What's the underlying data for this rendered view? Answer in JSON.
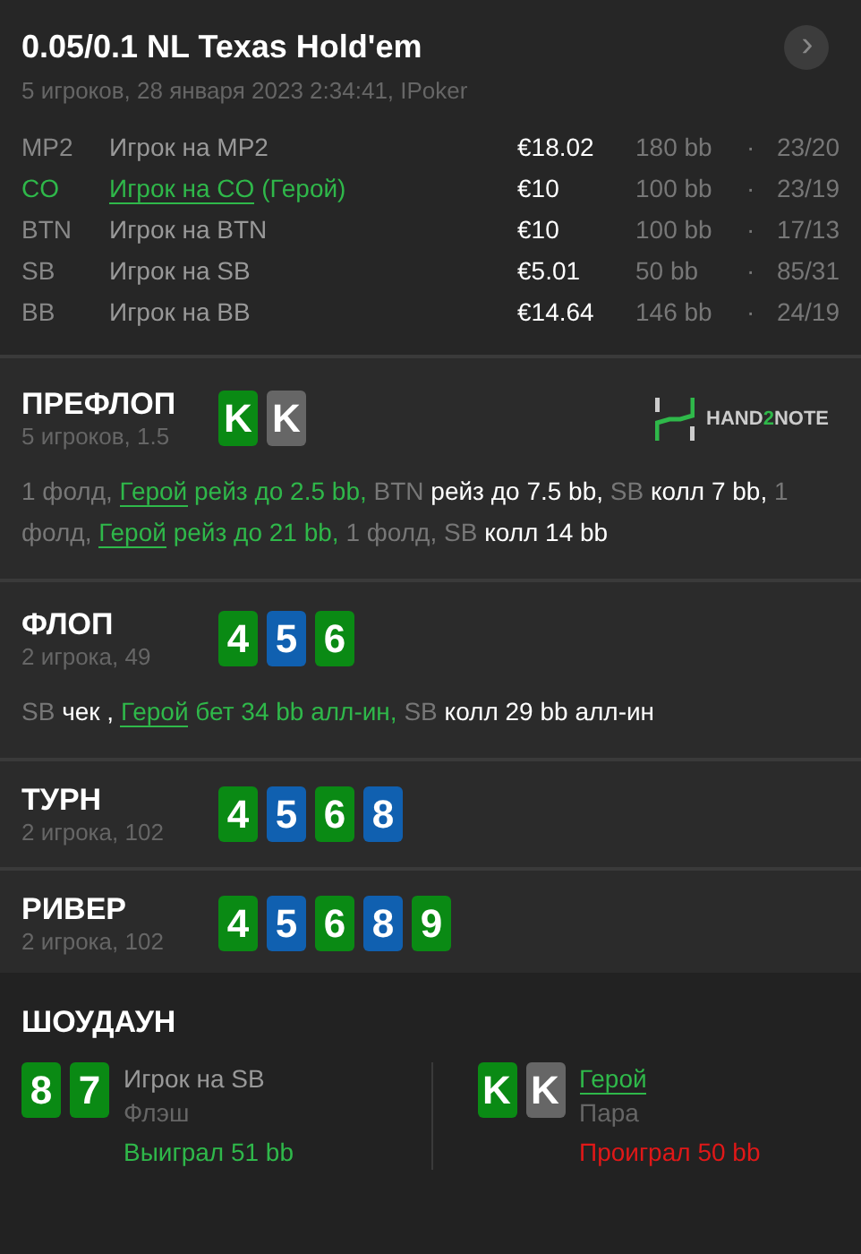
{
  "header": {
    "title": "0.05/0.1 NL Texas Hold'em",
    "subtitle": "5 игроков, 28 января 2023 2:34:41, IPoker",
    "next_button": "›",
    "players": [
      {
        "position": "MP2",
        "name": "Игрок на MP2",
        "hero": false,
        "stack": "€18.02",
        "bb": "180 bb",
        "dot": "·",
        "stats": "23/20"
      },
      {
        "position": "CO",
        "name": "Игрок на CO",
        "hero_tag": "(Герой)",
        "hero": true,
        "stack": "€10",
        "bb": "100 bb",
        "dot": "·",
        "stats": "23/19"
      },
      {
        "position": "BTN",
        "name": "Игрок на BTN",
        "hero": false,
        "stack": "€10",
        "bb": "100 bb",
        "dot": "·",
        "stats": "17/13"
      },
      {
        "position": "SB",
        "name": "Игрок на SB",
        "hero": false,
        "stack": "€5.01",
        "bb": "50 bb",
        "dot": "·",
        "stats": "85/31"
      },
      {
        "position": "BB",
        "name": "Игрок на BB",
        "hero": false,
        "stack": "€14.64",
        "bb": "146 bb",
        "dot": "·",
        "stats": "24/19"
      }
    ]
  },
  "streets": [
    {
      "name": "ПРЕФЛОП",
      "info": "5 игроков, 1.5",
      "logo": [
        {
          "text": "HAND",
          "accent": false
        },
        {
          "text": "2",
          "accent": true
        },
        {
          "text": "NOTE",
          "accent": false
        }
      ],
      "cards": [
        {
          "rank": "K",
          "color": "#0a8a14"
        },
        {
          "rank": "K",
          "color": "#666666"
        }
      ],
      "actions": [
        {
          "kind": "muted",
          "text": "1 фолд, "
        },
        {
          "kind": "hero",
          "text": "Герой"
        },
        {
          "kind": "hero_action",
          "text": " рейз до 2.5 bb, "
        },
        {
          "kind": "muted",
          "text": "BTN "
        },
        {
          "kind": "plain",
          "text": "рейз до 7.5 bb, "
        },
        {
          "kind": "muted",
          "text": "SB "
        },
        {
          "kind": "plain",
          "text": "колл 7 bb, "
        },
        {
          "kind": "muted",
          "text": "1 фолд, "
        },
        {
          "kind": "hero",
          "text": "Герой"
        },
        {
          "kind": "hero_action",
          "text": " рейз до 21 bb, "
        },
        {
          "kind": "muted",
          "text": "1 фолд, SB "
        },
        {
          "kind": "plain",
          "text": "колл 14 bb"
        }
      ]
    },
    {
      "name": "ФЛОП",
      "info": "2 игрока, 49",
      "cards": [
        {
          "rank": "4",
          "color": "#0a8a14"
        },
        {
          "rank": "5",
          "color": "#1060b0"
        },
        {
          "rank": "6",
          "color": "#0a8a14"
        }
      ],
      "actions": [
        {
          "kind": "muted",
          "text": "SB "
        },
        {
          "kind": "plain",
          "text": "чек , "
        },
        {
          "kind": "hero",
          "text": "Герой"
        },
        {
          "kind": "hero_action",
          "text": " бет 34 bb алл-ин, "
        },
        {
          "kind": "muted",
          "text": "SB "
        },
        {
          "kind": "plain",
          "text": "колл 29 bb алл-ин"
        }
      ]
    },
    {
      "name": "ТУРН",
      "info": "2 игрока, 102",
      "cards": [
        {
          "rank": "4",
          "color": "#0a8a14"
        },
        {
          "rank": "5",
          "color": "#1060b0"
        },
        {
          "rank": "6",
          "color": "#0a8a14"
        },
        {
          "rank": "8",
          "color": "#1060b0"
        }
      ]
    },
    {
      "name": "РИВЕР",
      "info": "2 игрока, 102",
      "cards": [
        {
          "rank": "4",
          "color": "#0a8a14"
        },
        {
          "rank": "5",
          "color": "#1060b0"
        },
        {
          "rank": "6",
          "color": "#0a8a14"
        },
        {
          "rank": "8",
          "color": "#1060b0"
        },
        {
          "rank": "9",
          "color": "#0a8a14"
        }
      ]
    }
  ],
  "showdown": {
    "title": "ШОУДАУН",
    "hands": [
      {
        "cards": [
          {
            "rank": "8",
            "color": "#0a8a14"
          },
          {
            "rank": "7",
            "color": "#0a8a14"
          }
        ],
        "name": "Игрок на SB",
        "hero": false,
        "hand": "Флэш",
        "result": "Выиграл 51 bb",
        "won": true
      },
      {
        "cards": [
          {
            "rank": "K",
            "color": "#0a8a14"
          },
          {
            "rank": "K",
            "color": "#666666"
          }
        ],
        "name": "Герой",
        "hero": true,
        "hand": "Пара",
        "result": "Проиграл 50 bb",
        "won": false
      }
    ]
  }
}
